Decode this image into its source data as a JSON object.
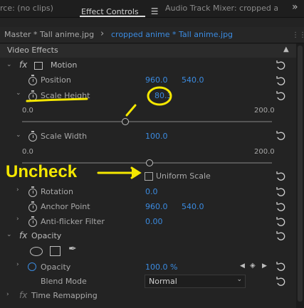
{
  "tabs": {
    "source": "rce: (no clips)",
    "effect_controls": "Effect Controls",
    "menu_glyph": "☰",
    "audio_mixer": "Audio Track Mixer: cropped an",
    "overflow": "»"
  },
  "subheader": {
    "master": "Master * Tall anime.jpg",
    "chevron": "›",
    "clip": "cropped anime * Tall anime.jpg"
  },
  "section_title": "Video Effects",
  "motion": {
    "fx": "fx",
    "label": "Motion",
    "position_label": "Position",
    "position_x": "960.0",
    "position_y": "540.0",
    "scale_height_label": "Scale Height",
    "scale_height_value": "80.3",
    "scale_height_min": "0.0",
    "scale_height_max": "200.0",
    "scale_width_label": "Scale Width",
    "scale_width_value": "100.0",
    "scale_width_min": "0.0",
    "scale_width_max": "200.0",
    "uniform_scale_label": "Uniform Scale",
    "rotation_label": "Rotation",
    "rotation_value": "0.0",
    "anchor_label": "Anchor Point",
    "anchor_x": "960.0",
    "anchor_y": "540.0",
    "antiflicker_label": "Anti-flicker Filter",
    "antiflicker_value": "0.00"
  },
  "opacity": {
    "fx": "fx",
    "label": "Opacity",
    "opacity_label": "Opacity",
    "opacity_value": "100.0 %",
    "blend_label": "Blend Mode",
    "blend_value": "Normal"
  },
  "time_remap": {
    "fx": "fx",
    "label": "Time Remapping"
  },
  "annotation": {
    "uncheck_text": "Uncheck",
    "color": "#f5e800"
  },
  "slider_levels": {
    "scale_height_fraction": 0.4015,
    "scale_width_fraction": 0.5
  }
}
